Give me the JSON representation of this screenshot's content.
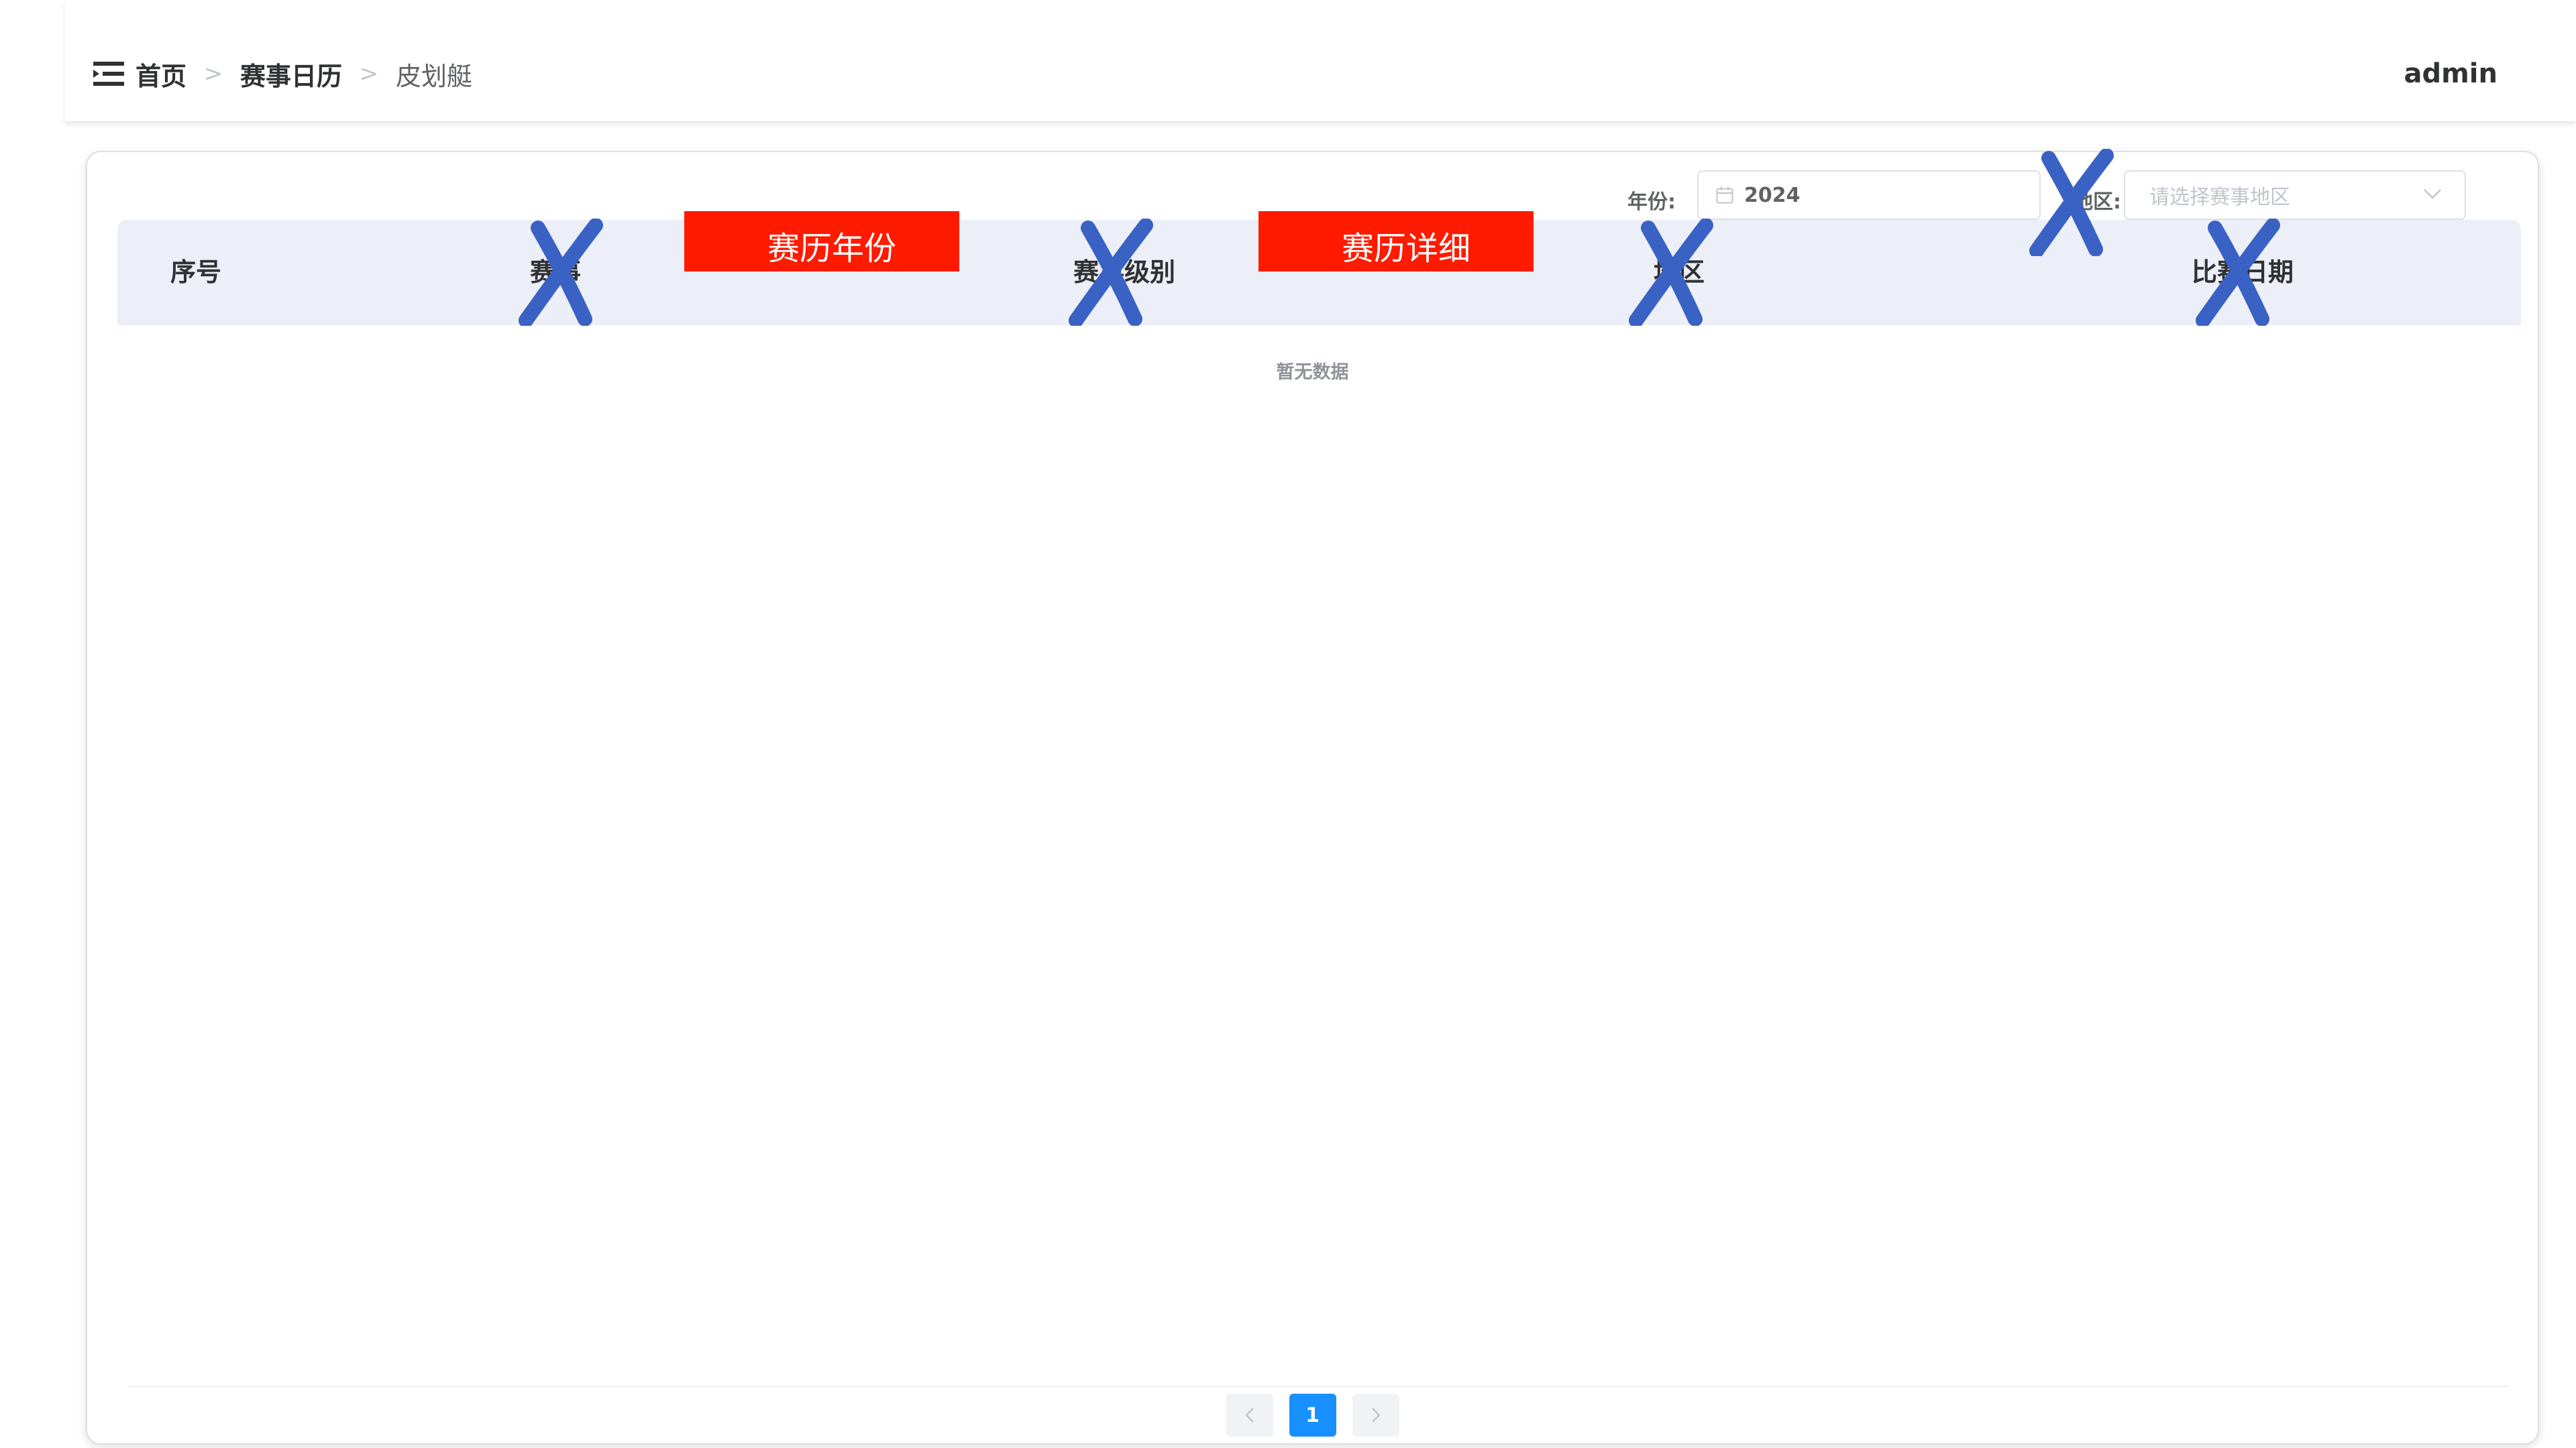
{
  "header": {
    "breadcrumb": [
      "首页",
      "赛事日历",
      "皮划艇"
    ],
    "user": "admin"
  },
  "filters": {
    "year_label": "年份:",
    "year_value": "2024",
    "region_label": "地区:",
    "region_placeholder": "请选择赛事地区"
  },
  "table": {
    "columns": [
      "序号",
      "赛事",
      "赛事级别",
      "地区",
      "比赛日期"
    ],
    "empty_text": "暂无数据"
  },
  "pagination": {
    "current_page": "1"
  },
  "annotations": {
    "label_1": "赛历年份",
    "label_2": "赛历详细",
    "box_color": "#ff1a00",
    "x_color": "#3a62c4"
  },
  "icons": {
    "menu": "menu-fold-icon",
    "calendar": "calendar-icon",
    "chevron": "chevron-down-icon",
    "prev": "chevron-left-icon",
    "next": "chevron-right-icon"
  }
}
